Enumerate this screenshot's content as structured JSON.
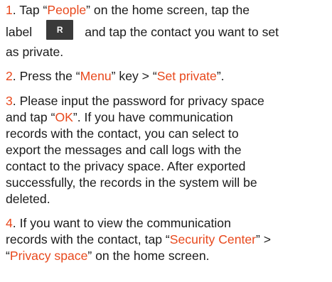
{
  "steps": [
    {
      "number": "1",
      "parts": {
        "a": ". Tap “",
        "b": "People",
        "c": "” on the home screen, tap the",
        "d": "label",
        "e": "and tap the contact you want to set",
        "f": "as private."
      },
      "icon_glyph": "R",
      "icon_name": "person-label-icon"
    },
    {
      "number": "2",
      "parts": {
        "a": ". Press the “",
        "b": "Menu",
        "c": "” key > “",
        "d": "Set private",
        "e": "”."
      }
    },
    {
      "number": "3",
      "parts": {
        "a": ". Please input the password for privacy space",
        "b": "and tap “",
        "c": "OK",
        "d": "”. If you have communication",
        "e": "records with the contact, you can select to",
        "f": "export the messages and call logs with the",
        "g": "contact to the privacy space. After exported",
        "h": "successfully, the records in the system will be",
        "i": "deleted."
      }
    },
    {
      "number": "4",
      "parts": {
        "a": ". If you want to view the communication",
        "b": "records with the contact, tap “",
        "c": "Security Center",
        "d": "” >",
        "e": "“",
        "f": "Privacy space",
        "g": "” on the home screen."
      }
    }
  ],
  "colors": {
    "highlight": "#e8481c",
    "text": "#1a1a1a"
  }
}
